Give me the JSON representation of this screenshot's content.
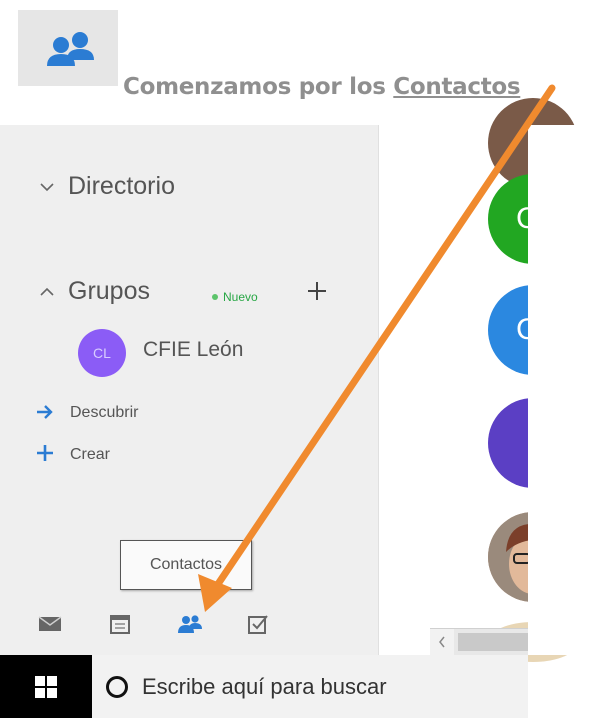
{
  "heading": {
    "prefix": "Comenzamos por los ",
    "link": "Contactos"
  },
  "sidebar": {
    "directory": "Directorio",
    "groups": "Grupos",
    "new_badge": "Nuevo",
    "group_item": "CFIE León",
    "group_initial": "CL",
    "actions": [
      {
        "label": "Descubrir"
      },
      {
        "label": "Crear"
      }
    ]
  },
  "tooltip": "Contactos",
  "contacts": [
    {
      "initial": "C",
      "color": "#22a722"
    },
    {
      "initial": "C",
      "color": "#2b88e0"
    },
    {
      "initial": "",
      "color": "#5b3fc4"
    }
  ],
  "taskbar": {
    "search_placeholder": "Escribe aquí para buscar"
  },
  "colors": {
    "accent": "#2b7cd3",
    "arrow": "#f08a2e"
  }
}
